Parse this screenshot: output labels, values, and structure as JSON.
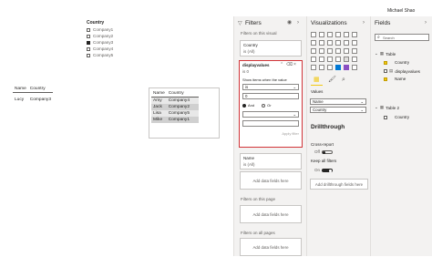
{
  "user": {
    "name": "Michael Shao"
  },
  "slicer": {
    "title": "Country",
    "items": [
      {
        "label": "Company1",
        "checked": false
      },
      {
        "label": "Company2",
        "checked": false
      },
      {
        "label": "Company3",
        "checked": true
      },
      {
        "label": "Company4",
        "checked": false
      },
      {
        "label": "Company5",
        "checked": false
      }
    ]
  },
  "table1": {
    "headers": [
      "Name",
      "Country"
    ],
    "rows": [
      [
        "Lucy",
        "Company3"
      ]
    ]
  },
  "table2": {
    "headers": [
      "Name",
      "Country"
    ],
    "rows": [
      [
        "Amy",
        "Company4"
      ],
      [
        "Jack",
        "Company2"
      ],
      [
        "Lisa",
        "Company5"
      ],
      [
        "Mike",
        "Company1"
      ]
    ]
  },
  "filters": {
    "title": "Filters",
    "on_visual_label": "Filters on this visual",
    "country_card": {
      "name": "Country",
      "value": "is (All)"
    },
    "displayvalues_card": {
      "name": "displayvalues",
      "value": "is 0",
      "show_items_label": "Show items when the value",
      "operator": "is",
      "operand": "0",
      "and_label": "And",
      "or_label": "Or",
      "apply_label": "Apply filter"
    },
    "name_card": {
      "name": "Name",
      "value": "is (All)"
    },
    "add_fields_label": "Add data fields here",
    "on_page_label": "Filters on this page",
    "on_all_pages_label": "Filters on all pages"
  },
  "visualizations": {
    "title": "Visualizations",
    "values_label": "Values",
    "value_fields": [
      "Name",
      "Country"
    ],
    "drillthrough_title": "Drillthrough",
    "cross_report_label": "Cross-report",
    "cross_report_state": "Off",
    "keep_filters_label": "Keep all filters",
    "keep_filters_state": "On",
    "add_drillthrough_label": "Add drillthrough fields here"
  },
  "fields": {
    "title": "Fields",
    "search_placeholder": "Search",
    "table1": {
      "name": "Table",
      "fields": [
        {
          "label": "Country",
          "checked": true
        },
        {
          "label": "displayvalues",
          "checked": false
        },
        {
          "label": "Name",
          "checked": true
        }
      ]
    },
    "table2": {
      "name": "Table 2",
      "fields": [
        {
          "label": "Country",
          "checked": false
        }
      ]
    }
  },
  "colors": {
    "highlight_border": "#d13438",
    "accent": "#f2c811"
  }
}
